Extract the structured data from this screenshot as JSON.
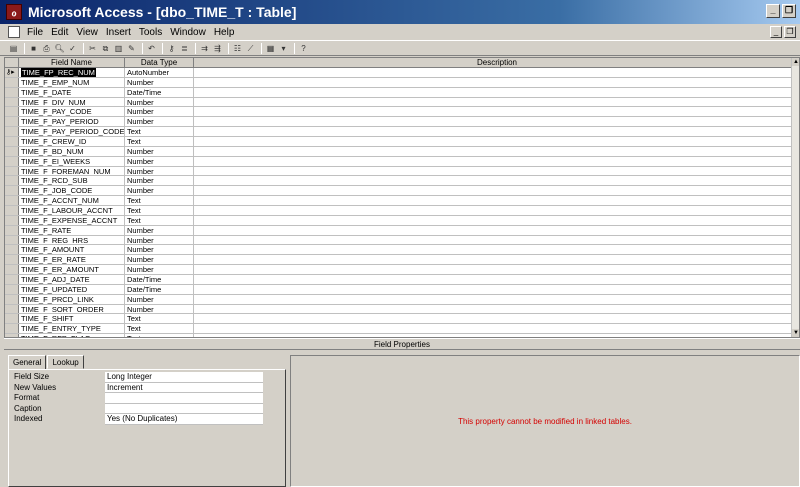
{
  "window": {
    "title": "Microsoft Access - [dbo_TIME_T : Table]",
    "app_icon_glyph": "ℴ"
  },
  "menu": [
    "File",
    "Edit",
    "View",
    "Insert",
    "Tools",
    "Window",
    "Help"
  ],
  "grid": {
    "headers": [
      "Field Name",
      "Data Type",
      "Description"
    ],
    "rows": [
      [
        "TIME_FP_REC_NUM",
        "AutoNumber"
      ],
      [
        "TIME_F_EMP_NUM",
        "Number"
      ],
      [
        "TIME_F_DATE",
        "Date/Time"
      ],
      [
        "TIME_F_DIV_NUM",
        "Number"
      ],
      [
        "TIME_F_PAY_CODE",
        "Number"
      ],
      [
        "TIME_F_PAY_PERIOD",
        "Number"
      ],
      [
        "TIME_F_PAY_PERIOD_CODE",
        "Text"
      ],
      [
        "TIME_F_CREW_ID",
        "Text"
      ],
      [
        "TIME_F_BD_NUM",
        "Number"
      ],
      [
        "TIME_F_EI_WEEKS",
        "Number"
      ],
      [
        "TIME_F_FOREMAN_NUM",
        "Number"
      ],
      [
        "TIME_F_RCD_SUB",
        "Number"
      ],
      [
        "TIME_F_JOB_CODE",
        "Number"
      ],
      [
        "TIME_F_ACCNT_NUM",
        "Text"
      ],
      [
        "TIME_F_LABOUR_ACCNT",
        "Text"
      ],
      [
        "TIME_F_EXPENSE_ACCNT",
        "Text"
      ],
      [
        "TIME_F_RATE",
        "Number"
      ],
      [
        "TIME_F_REG_HRS",
        "Number"
      ],
      [
        "TIME_F_AMOUNT",
        "Number"
      ],
      [
        "TIME_F_ER_RATE",
        "Number"
      ],
      [
        "TIME_F_ER_AMOUNT",
        "Number"
      ],
      [
        "TIME_F_ADJ_DATE",
        "Date/Time"
      ],
      [
        "TIME_F_UPDATED",
        "Date/Time"
      ],
      [
        "TIME_F_PRCD_LINK",
        "Number"
      ],
      [
        "TIME_F_SORT_ORDER",
        "Number"
      ],
      [
        "TIME_F_SHIFT",
        "Text"
      ],
      [
        "TIME_F_ENTRY_TYPE",
        "Text"
      ],
      [
        "TIME_F_RFP_FLAG",
        "Text"
      ]
    ]
  },
  "field_properties": {
    "band_label": "Field Properties",
    "tabs": [
      "General",
      "Lookup"
    ],
    "props": [
      {
        "label": "Field Size",
        "value": "Long Integer"
      },
      {
        "label": "New Values",
        "value": "Increment"
      },
      {
        "label": "Format",
        "value": ""
      },
      {
        "label": "Caption",
        "value": ""
      },
      {
        "label": "Indexed",
        "value": "Yes (No Duplicates)"
      }
    ],
    "help_text": "This property cannot be modified in linked tables."
  },
  "colors": {
    "help_text": "#d40000",
    "titlebar_start": "#0a246a"
  }
}
